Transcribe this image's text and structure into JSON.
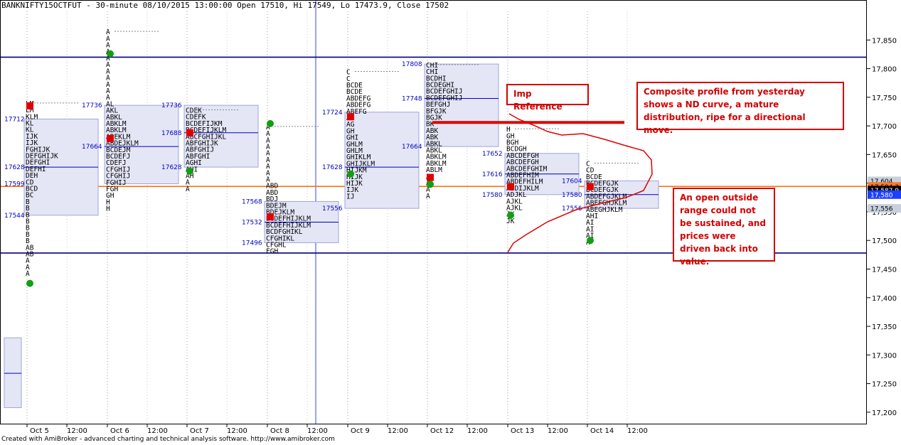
{
  "header": {
    "title": "BANKNIFTY15OCTFUT - 30-minute 08/10/2015 13:00:00 Open 17510, Hi 17549, Lo 17473.9, Close 17502"
  },
  "footer": {
    "credit": "Created with AmiBroker - advanced charting and technical analysis software. http://www.amibroker.com"
  },
  "annotations": {
    "imp_reference": "Imp Reference",
    "composite": "Composite profile from yesterday shows a ND curve, a mature distribution, ripe for a directional move.",
    "outside_range": "An open outside range could not be sustained, and prices were driven back into value."
  },
  "chart_data": {
    "type": "market-profile",
    "instrument": "BANKNIFTY15OCTFUT",
    "interval": "30-minute",
    "ylim": [
      17180,
      17900
    ],
    "y_ticks": [
      17200,
      17250,
      17300,
      17350,
      17400,
      17450,
      17500,
      17550,
      17600,
      17650,
      17700,
      17750,
      17800,
      17850
    ],
    "x_labels": [
      "Oct 5",
      "12:00",
      "Oct 6",
      "12:00",
      "Oct 7",
      "12:00",
      "Oct 8",
      "12:00",
      "Oct 9",
      "12:00",
      "Oct 12",
      "12:00",
      "Oct 13",
      "12:00",
      "Oct 14",
      "12:00"
    ],
    "horizontal_lines": [
      {
        "price": 17820,
        "color": "#000080"
      },
      {
        "price": 17478,
        "color": "#000080"
      },
      {
        "price": 17594.3,
        "color": "#ff6a00"
      }
    ],
    "price_badges": [
      {
        "label": "17,604",
        "price": 17604,
        "color": "#c8d0dc"
      },
      {
        "label": "17,594.3",
        "price": 17594.3,
        "color": "#ff7a2a"
      },
      {
        "label": "17,587.9",
        "price": 17587.9,
        "color": "#000000"
      },
      {
        "label": "17,580",
        "price": 17580,
        "color": "#1f3fff"
      },
      {
        "label": "17,556",
        "price": 17556,
        "color": "#c8d0dc"
      }
    ],
    "days": [
      {
        "day": "Oct 5",
        "va_high": 17712,
        "poc": 17628,
        "va_low": 17544,
        "poc_label": "17628",
        "high_label": "17712",
        "low_label": "17544",
        "extra_label": "17599",
        "extra_price": 17599,
        "tpo": [
          "LM",
          "LM",
          "KLM",
          "KL",
          "KL",
          "IJK",
          "IJK",
          "FGHIJK",
          "DEFGHIJK",
          "DEFGHI",
          "DEFHI",
          "DEH",
          "CD",
          "BCD",
          "BC",
          "B",
          "B",
          "B",
          "B",
          "B",
          "B",
          "B",
          "AB",
          "AB",
          "A",
          "A",
          "A"
        ],
        "tpo_top": 17745,
        "open": 17735,
        "close": 17425
      },
      {
        "day": "Oct 6",
        "va_high": 17736,
        "poc": 17664,
        "va_low": 17599,
        "poc_label": "17664",
        "high_label": "17736",
        "low_label": "",
        "tpo": [
          "A",
          "A",
          "A",
          "A",
          "A",
          "A",
          "A",
          "A",
          "A",
          "A",
          "A",
          "AL",
          "AKL",
          "ABKL",
          "ABKLM",
          "ABKLM",
          "ABEKLM",
          "ABDEJKLM",
          "BCDEJM",
          "BCDEFJ",
          "CDEFJ",
          "CFGHIJ",
          "CFGHIJ",
          "FGHIJ",
          "FGH",
          "GH",
          "H",
          "H"
        ],
        "tpo_top": 17870,
        "open": 17678,
        "close": 17826
      },
      {
        "day": "Oct 7",
        "va_high": 17736,
        "poc": 17688,
        "va_low": 17628,
        "poc_label": "17688",
        "high_label": "17736",
        "low_label": "17628",
        "tpo": [
          "CDEK",
          "CDEFK",
          "BCDEFIJKM",
          "BCDEFIJKLM",
          "ABCFGHIJKL",
          "ABFGHIJK",
          "ABFGHIJ",
          "ABFGHI",
          "AGHI",
          "AHI",
          "AH",
          "A",
          "A"
        ],
        "tpo_top": 17733,
        "open": 17688,
        "close": 17621
      },
      {
        "day": "Oct 8",
        "va_high": 17568,
        "poc": 17532,
        "va_low": 17496,
        "poc_label": "17532",
        "high_label": "17568",
        "low_label": "17496",
        "tpo": [
          "A",
          "A",
          "A",
          "A",
          "A",
          "A",
          "A",
          "A",
          "A",
          "ABD",
          "ABD",
          "BDJ",
          "BDEJM",
          "BDEJKLM",
          "BCDEFHIJKLM",
          "BCDEFHIJKLM",
          "BCDFGHIKL",
          "CFGHIKL",
          "CFGHL",
          "FGH"
        ],
        "tpo_top": 17704,
        "open": 17541,
        "close": 17704
      },
      {
        "day": "Oct 9",
        "va_high": 17724,
        "poc": 17628,
        "va_low": 17556,
        "poc_label": "17628",
        "high_label": "17724",
        "low_label": "17556",
        "tpo": [
          "C",
          "C",
          "BCDE",
          "BCDE",
          "ABDEFG",
          "ABDEFG",
          "ABEFG",
          "AG",
          "AG",
          "GH",
          "GHI",
          "GHLM",
          "GHLM",
          "GHIKLM",
          "GHIJKLM",
          "HIJKM",
          "HIJK",
          "HIJK",
          "IJK",
          "IJ"
        ],
        "tpo_top": 17800,
        "open": 17716,
        "close": 17616
      },
      {
        "day": "Oct 12",
        "va_high": 17808,
        "poc": 17748,
        "va_low": 17664,
        "poc_label": "17748",
        "high_label": "17808",
        "low_label": "17664",
        "tpo": [
          "CHI",
          "CHI",
          "BCDHI",
          "BCDEGHI",
          "BCDEFGHIJ",
          "BCDEFGHIJ",
          "BEFGHJ",
          "BFGJK",
          "BGJK",
          "BK",
          "ABK",
          "ABK",
          "ABKL",
          "ABKL",
          "ABKLM",
          "ABKLM",
          "ABLM",
          "AL",
          "A",
          "A",
          "A"
        ],
        "tpo_top": 17812,
        "open": 17610,
        "close": 17598
      },
      {
        "day": "Oct 13",
        "va_high": 17652,
        "poc": 17616,
        "va_low": 17580,
        "poc_label": "17616",
        "high_label": "17652",
        "low_label": "17580",
        "tpo": [
          "H",
          "GH",
          "BGH",
          "BCDGH",
          "ABCDEFGH",
          "ABCDEFGH",
          "ABCDEFGHIM",
          "ABDEFHIM",
          "ABDEFHILM",
          "ABDIJKLM",
          "ADJKL",
          "AJKL",
          "AJKL",
          "JK",
          "JK"
        ],
        "tpo_top": 17700,
        "open": 17594,
        "close": 17544
      },
      {
        "day": "Oct 14",
        "va_high": 17604,
        "poc": 17580,
        "va_low": 17556,
        "poc_label": "17580",
        "high_label": "17604",
        "low_label": "17556",
        "tpo": [
          "C",
          "CD",
          "BCDE",
          "BCDEFGJK",
          "BCDEFGJK",
          "ABDEFGJKLM",
          "ABEFGHJKLM",
          "ABEGHJKLM",
          "AHI",
          "AI",
          "AI",
          "AI",
          "A"
        ],
        "tpo_top": 17640,
        "open": 17594,
        "close": 17500
      }
    ]
  }
}
